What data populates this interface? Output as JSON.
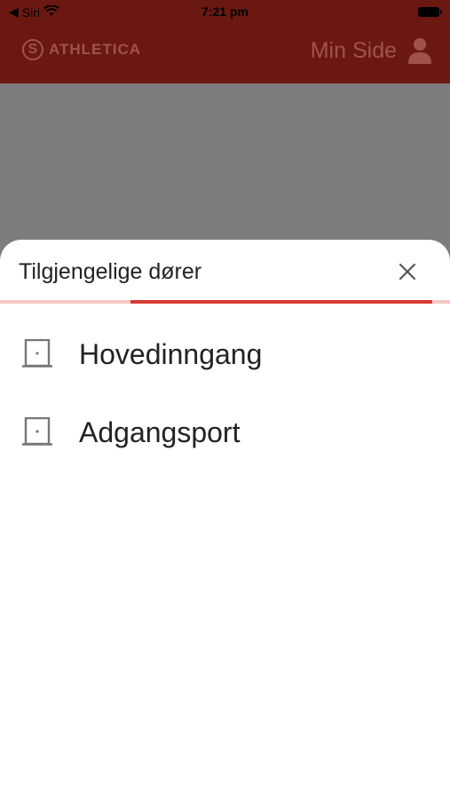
{
  "status_bar": {
    "back_label": "Siri",
    "time": "7:21 pm"
  },
  "header": {
    "brand_mark": "S",
    "brand_name": "ATHLETICA",
    "user_label": "Min Side"
  },
  "sheet": {
    "title": "Tilgjengelige dører",
    "progress_fraction": 0.67,
    "doors": [
      {
        "label": "Hovedinngang",
        "icon": "door-icon"
      },
      {
        "label": "Adgangsport",
        "icon": "door-icon"
      }
    ]
  },
  "colors": {
    "header_bg": "#6b1812",
    "accent": "#d63a32",
    "accent_light": "#f6c8c5",
    "dim_overlay": "#7d7d7d"
  }
}
